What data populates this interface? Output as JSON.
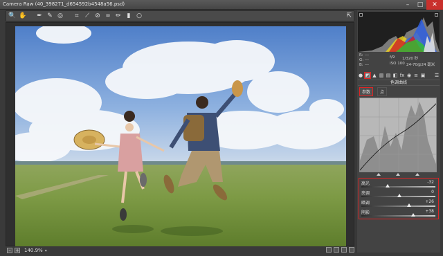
{
  "window": {
    "title": "Camera Raw (40_398271_d654592b4548a56.psd)",
    "buttons": {
      "minimize": "–",
      "maximize": "□",
      "close": "✕"
    }
  },
  "toolbar": {
    "tools": [
      {
        "name": "zoom-tool-icon",
        "glyph": "🔍"
      },
      {
        "name": "hand-tool-icon",
        "glyph": "✋"
      },
      {
        "name": "white-balance-tool-icon",
        "glyph": "✒"
      },
      {
        "name": "color-sampler-tool-icon",
        "glyph": "✎"
      },
      {
        "name": "targeted-adjustment-tool-icon",
        "glyph": "◎"
      },
      {
        "name": "crop-tool-icon",
        "glyph": "⌗"
      },
      {
        "name": "straighten-tool-icon",
        "glyph": "⟋"
      },
      {
        "name": "spot-removal-tool-icon",
        "glyph": "⊘"
      },
      {
        "name": "red-eye-tool-icon",
        "glyph": "∞"
      },
      {
        "name": "adjustment-brush-icon",
        "glyph": "✏"
      },
      {
        "name": "graduated-filter-icon",
        "glyph": "▮"
      },
      {
        "name": "radial-filter-icon",
        "glyph": "○"
      }
    ],
    "fullscreen_glyph": "⇱"
  },
  "status": {
    "zoom": "140.9%",
    "minus": "–",
    "plus": "+",
    "zoom_arrow": "▾"
  },
  "info": {
    "r_label": "R:",
    "r_value": "---",
    "g_label": "G:",
    "g_value": "---",
    "b_label": "B:",
    "b_value": "---",
    "aperture": "f/9",
    "shutter": "1/320 秒",
    "iso": "ISO 100",
    "lens": "24-70@24 毫米"
  },
  "panel": {
    "section_title": "色调曲线",
    "subtabs": [
      "参数",
      "点"
    ],
    "active_subtab": 0,
    "tab_icons": [
      "aperture-tab-icon",
      "curve-tab-icon",
      "detail-tab-icon",
      "hsl-tab-icon",
      "split-tone-tab-icon",
      "lens-tab-icon",
      "fx-tab-icon",
      "camera-tab-icon",
      "presets-tab-icon",
      "snapshots-tab-icon"
    ]
  },
  "tone_sliders": [
    {
      "label": "高光",
      "value": "-32",
      "level": -32
    },
    {
      "label": "亮调",
      "value": "0",
      "level": 0
    },
    {
      "label": "暗调",
      "value": "+26",
      "level": 26
    },
    {
      "label": "阴影",
      "value": "+38",
      "level": 38
    }
  ],
  "colors": {
    "highlight_border": "#e02424",
    "panel_bg": "#434343",
    "window_bg": "#3a3a3a"
  }
}
